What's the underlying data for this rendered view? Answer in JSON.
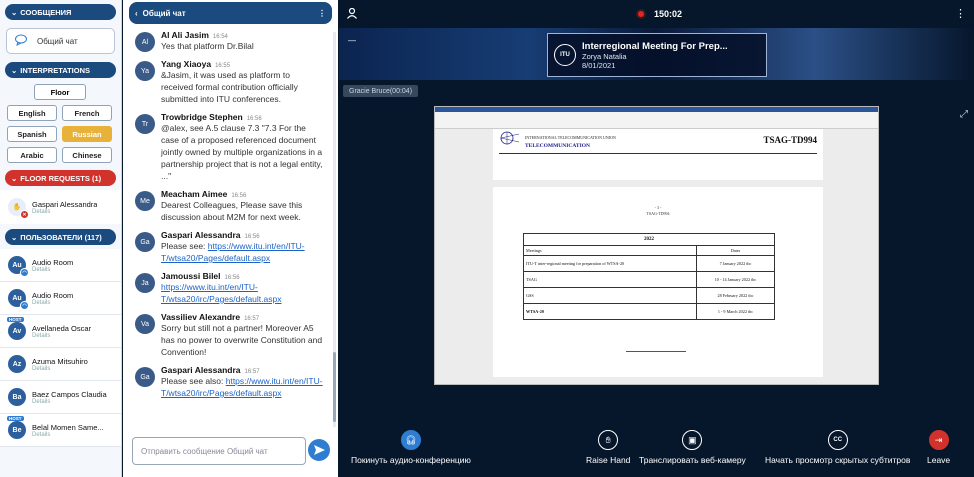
{
  "sidebar": {
    "messages_header": "СООБЩЕНИЯ",
    "chat_item": "Общий чат",
    "interpretations_header": "INTERPRETATIONS",
    "floor_label": "Floor",
    "languages": [
      {
        "label": "English",
        "active": false
      },
      {
        "label": "French",
        "active": false
      },
      {
        "label": "Spanish",
        "active": false
      },
      {
        "label": "Russian",
        "active": true
      },
      {
        "label": "Arabic",
        "active": false
      },
      {
        "label": "Chinese",
        "active": false
      }
    ],
    "floor_requests_header": "FLOOR REQUESTS (1)",
    "floor_request": {
      "name": "Gaspari Alessandra",
      "sub": "Details"
    },
    "users_header": "ПОЛЬЗОВАТЕЛИ (117)",
    "users": [
      {
        "initials": "Au",
        "name": "Audio Room",
        "sub": "Details"
      },
      {
        "initials": "Au",
        "name": "Audio Room",
        "sub": "Details"
      },
      {
        "initials": "Av",
        "name": "Avellaneda Oscar",
        "sub": "Details",
        "tag": "HOST"
      },
      {
        "initials": "Az",
        "name": "Azuma Mitsuhiro",
        "sub": "Details"
      },
      {
        "initials": "Ba",
        "name": "Baez Campos Claudia",
        "sub": "Details"
      },
      {
        "initials": "Be",
        "name": "Belal Momen Same...",
        "sub": "Details",
        "tag": "HOST"
      }
    ]
  },
  "chat": {
    "title": "Общий чат",
    "input_placeholder": "Отправить сообщение Общий чат",
    "messages": [
      {
        "initials": "Al",
        "name": "Al Ali Jasim",
        "time": "16:54",
        "text": "Yes that platform Dr.Bilal"
      },
      {
        "initials": "Ya",
        "name": "Yang Xiaoya",
        "time": "16:55",
        "text": "&Jasim, it was used as platform to received formal contribution officially submitted into ITU conferences."
      },
      {
        "initials": "Tr",
        "name": "Trowbridge Stephen",
        "time": "16:56",
        "text": "@alex, see A.5 clause 7.3 \"7.3 For the case of a proposed referenced document jointly owned by multiple organizations in a partnership project that is not a legal entity, ...\""
      },
      {
        "initials": "Me",
        "name": "Meacham Aimee",
        "time": "16:56",
        "text": "Dearest Colleagues, Please save this discussion about M2M for next week."
      },
      {
        "initials": "Ga",
        "name": "Gaspari Alessandra",
        "time": "16:56",
        "text": "Please see: ",
        "link": "https://www.itu.int/en/ITU-T/wtsa20/Pages/default.aspx"
      },
      {
        "initials": "Ja",
        "name": "Jamoussi Bilel",
        "time": "16:56",
        "text": "",
        "link": "https://www.itu.int/en/ITU-T/wtsa20/irc/Pages/default.aspx"
      },
      {
        "initials": "Va",
        "name": "Vassiliev Alexandre",
        "time": "16:57",
        "text": "Sorry but still not a partner! Moreover A5 has no power to overwrite Constitution and Convention!"
      },
      {
        "initials": "Ga",
        "name": "Gaspari Alessandra",
        "time": "16:57",
        "text": "Please see also: ",
        "link": "https://www.itu.int/en/ITU-T/wtsa20/irc/Pages/default.aspx"
      }
    ]
  },
  "main": {
    "timer": "150:02",
    "banner_title": "Interregional Meeting For Prep...",
    "banner_presenter": "Zorya Natalia",
    "banner_date": "8/01/2021",
    "logo_text": "ITU",
    "speaker_label": "Gracie Bruce(00:04)",
    "document": {
      "org_line": "INTERNATIONAL TELECOMMUNICATION UNION",
      "telecom": "TELECOMMUNICATION",
      "doc_code": "TSAG-TD994",
      "page_num": "- 3 -",
      "page_ref": "TSAG-TD994",
      "year": "2022",
      "col_meetings": "Meetings",
      "col_dates": "Dates",
      "rows": [
        {
          "meeting": "ITU-T inter-regional meeting for preparation of WTSA-20",
          "date": "7 January 2022 tbc",
          "bold": false
        },
        {
          "meeting": "TSAG",
          "date": "10 - 14 January 2022 tbc",
          "bold": false
        },
        {
          "meeting": "GSS",
          "date": "28 February 2022 tbc",
          "bold": false
        },
        {
          "meeting": "WTSA-20",
          "date": "1 - 9 March 2022 tbc",
          "bold": true
        }
      ]
    },
    "controls": {
      "leave_audio": "Покинуть аудио-конференцию",
      "raise_hand": "Raise Hand",
      "share_webcam": "Транслировать веб-камеру",
      "captions": "Начать просмотр скрытых субтитров",
      "leave": "Leave"
    }
  }
}
